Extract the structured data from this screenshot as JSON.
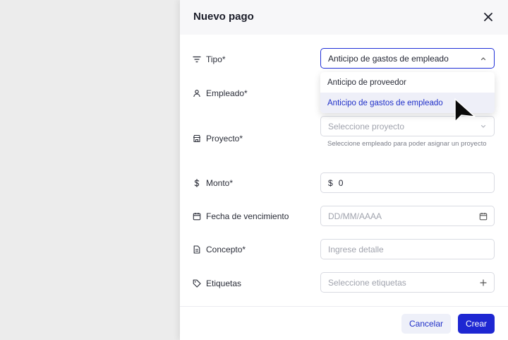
{
  "header": {
    "title": "Nuevo pago"
  },
  "fields": {
    "tipo": {
      "label": "Tipo*",
      "value": "Anticipo de gastos de empleado"
    },
    "empleado": {
      "label": "Empleado*"
    },
    "proyecto": {
      "label": "Proyecto*",
      "placeholder": "Seleccione proyecto",
      "helper": "Seleccione empleado para poder asignar un proyecto"
    },
    "monto": {
      "label": "Monto*",
      "currency": "$",
      "value": "0"
    },
    "fecha": {
      "label": "Fecha de vencimiento",
      "placeholder": "DD/MM/AAAA"
    },
    "concepto": {
      "label": "Concepto*",
      "placeholder": "Ingrese detalle"
    },
    "etiquetas": {
      "label": "Etiquetas",
      "placeholder": "Seleccione etiquetas"
    }
  },
  "dropdown": {
    "options": [
      "Anticipo de proveedor",
      "Anticipo de gastos de empleado"
    ],
    "selected_index": 1
  },
  "footer": {
    "cancel_label": "Cancelar",
    "create_label": "Crear"
  },
  "colors": {
    "accent": "#1e27d2",
    "selected_bg": "#eeeff8",
    "cancel_bg": "#eef0f9"
  }
}
